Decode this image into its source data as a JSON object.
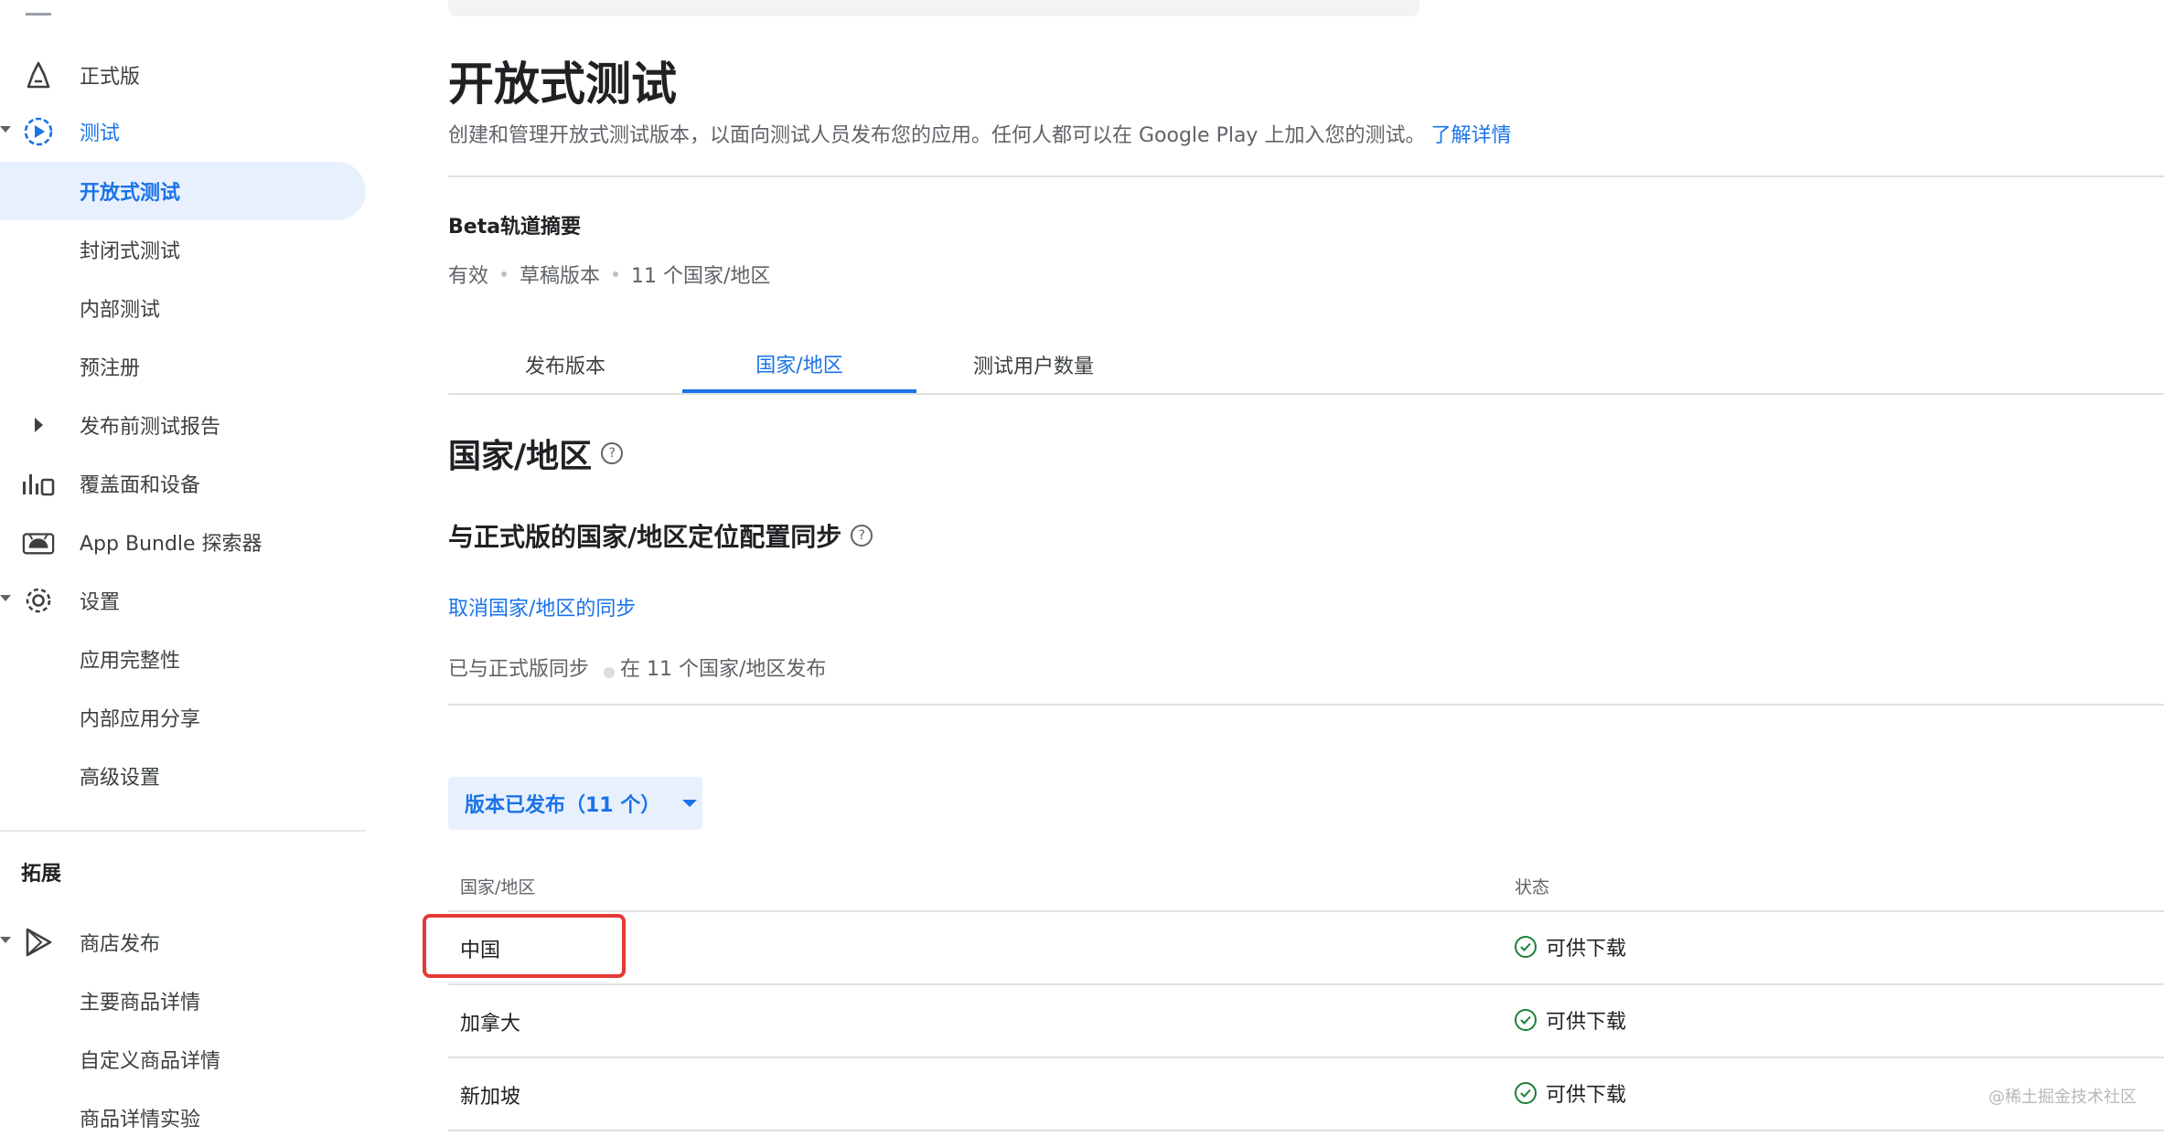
{
  "sidebar": {
    "items": [
      {
        "label": "正式版",
        "icon": "production-icon"
      },
      {
        "label": "测试",
        "icon": "testing-icon"
      },
      {
        "label": "开放式测试"
      },
      {
        "label": "封闭式测试"
      },
      {
        "label": "内部测试"
      },
      {
        "label": "预注册"
      },
      {
        "label": "发布前测试报告"
      },
      {
        "label": "覆盖面和设备",
        "icon": "bar-chart-icon"
      },
      {
        "label": "App Bundle 探索器",
        "icon": "android-icon"
      },
      {
        "label": "设置",
        "icon": "gear-icon"
      },
      {
        "label": "应用完整性"
      },
      {
        "label": "内部应用分享"
      },
      {
        "label": "高级设置"
      }
    ],
    "section_grow": "拓展",
    "grow_items": [
      {
        "label": "商店发布",
        "icon": "store-listing-icon"
      },
      {
        "label": "主要商品详情"
      },
      {
        "label": "自定义商品详情"
      },
      {
        "label": "商品详情实验"
      }
    ]
  },
  "main": {
    "title": "开放式测试",
    "description": "创建和管理开放式测试版本，以面向测试人员发布您的应用。任何人都可以在 Google Play 上加入您的测试。",
    "learn_more": "了解详情",
    "summary_title": "Beta轨道摘要",
    "summary": {
      "status": "有效",
      "draft": "草稿版本",
      "countries": "11 个国家/地区"
    },
    "tabs": [
      "发布版本",
      "国家/地区",
      "测试用户数量"
    ],
    "active_tab": "国家/地区",
    "section_title": "国家/地区",
    "sync_title": "与正式版的国家/地区定位配置同步",
    "unsync_link": "取消国家/地区的同步",
    "sync_status": "已与正式版同步",
    "sync_release": "在 11 个国家/地区发布",
    "filter_label": "版本已发布（11 个）",
    "table": {
      "headers": {
        "country": "国家/地区",
        "status": "状态"
      },
      "rows": [
        {
          "country": "中国",
          "status": "可供下载"
        },
        {
          "country": "加拿大",
          "status": "可供下载"
        },
        {
          "country": "新加坡",
          "status": "可供下载"
        }
      ]
    }
  },
  "watermark": "@稀土掘金技术社区",
  "colors": {
    "accent": "#1a73e8",
    "selected_bg": "#e8f0fe",
    "highlight": "#e53935",
    "success": "#188038"
  }
}
